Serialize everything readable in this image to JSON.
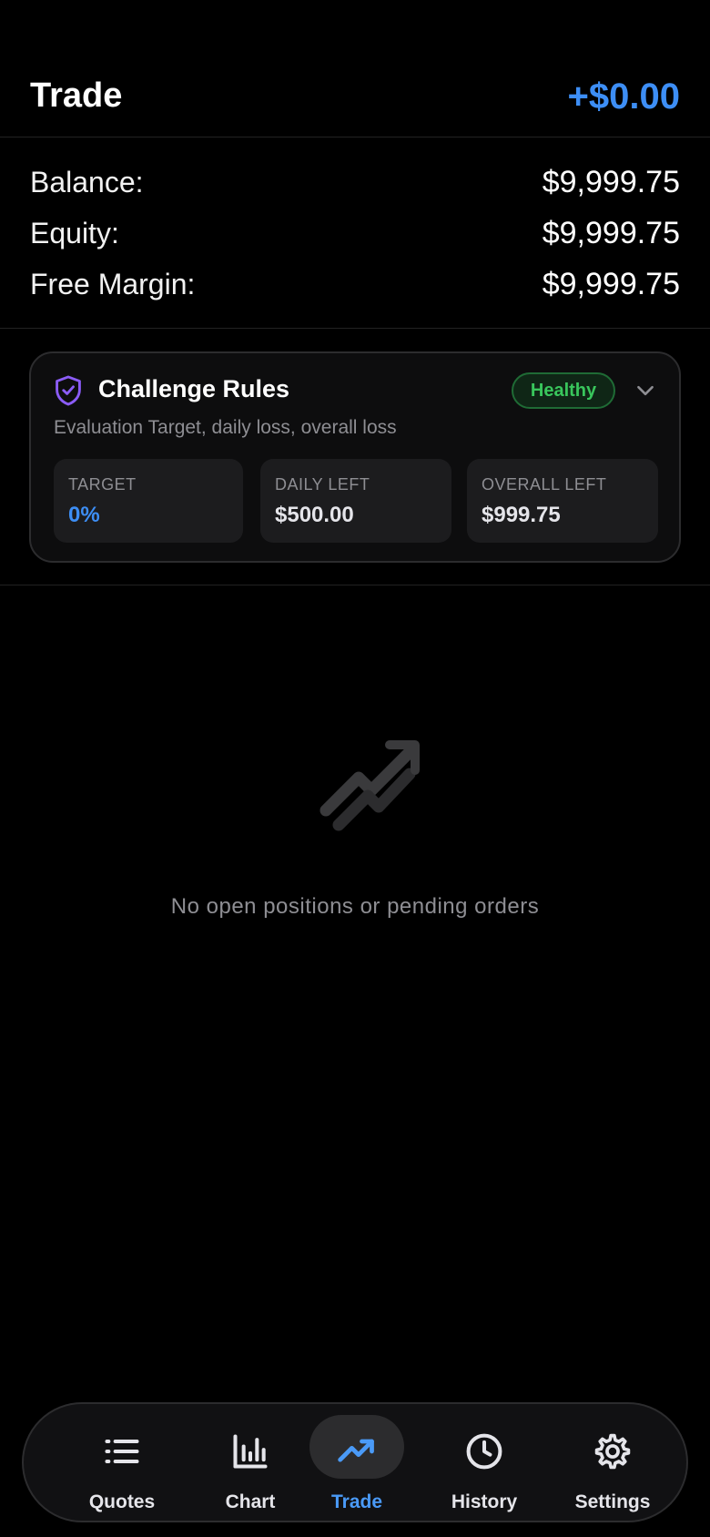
{
  "header": {
    "title": "Trade",
    "pnl": "+$0.00"
  },
  "account": [
    {
      "label": "Balance:",
      "value": "$9,999.75"
    },
    {
      "label": "Equity:",
      "value": "$9,999.75"
    },
    {
      "label": "Free Margin:",
      "value": "$9,999.75"
    }
  ],
  "rules": {
    "title": "Challenge Rules",
    "badge": "Healthy",
    "subtitle": "Evaluation Target, daily loss, overall loss",
    "stats": [
      {
        "label": "TARGET",
        "value": "0%"
      },
      {
        "label": "DAILY LEFT",
        "value": "$500.00"
      },
      {
        "label": "OVERALL LEFT",
        "value": "$999.75"
      }
    ]
  },
  "empty": {
    "icon": "trending-up-icon",
    "text": "No open positions or pending orders"
  },
  "tabs": [
    {
      "label": "Quotes",
      "icon": "list-icon"
    },
    {
      "label": "Chart",
      "icon": "bar-chart-icon"
    },
    {
      "label": "Trade",
      "icon": "trending-up-icon",
      "active": true
    },
    {
      "label": "History",
      "icon": "clock-icon"
    },
    {
      "label": "Settings",
      "icon": "gear-icon"
    }
  ],
  "colors": {
    "accent": "#3d8ef5",
    "healthy": "#39c65c",
    "shield": "#8b5cf6"
  }
}
